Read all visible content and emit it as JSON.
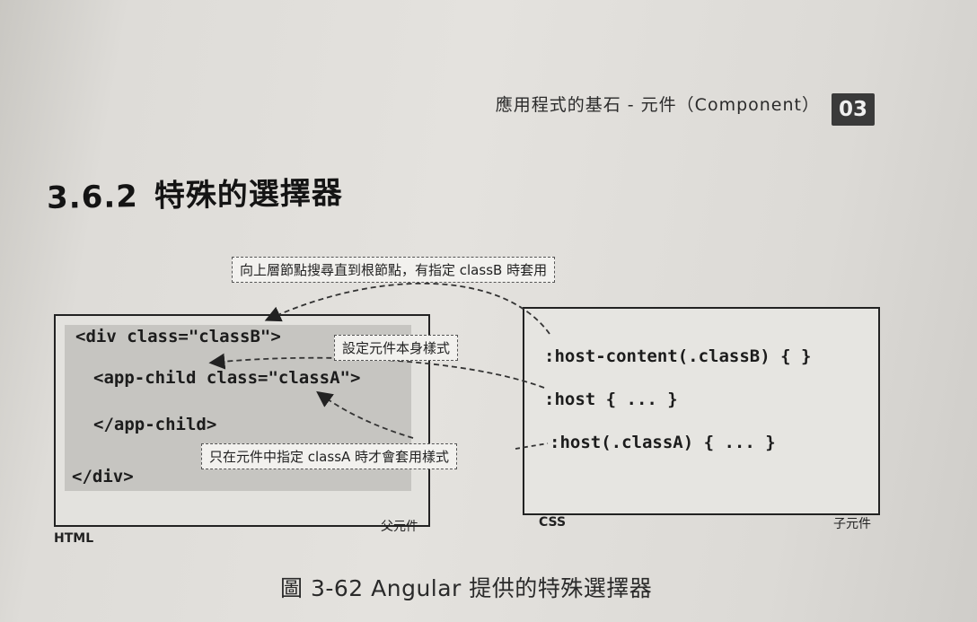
{
  "header": {
    "running_head": "應用程式的基石 - 元件（Component）",
    "chapter_number": "03"
  },
  "section": {
    "number": "3.6.2",
    "title": "特殊的選擇器"
  },
  "figure": {
    "callouts": {
      "top": "向上層節點搜尋直到根節點，有指定 classB 時套用",
      "middle": "設定元件本身樣式",
      "bottom": "只在元件中指定 classA 時才會套用樣式"
    },
    "html_code": [
      "<div class=\"classB\">",
      "<app-child class=\"classA\">",
      "</app-child>",
      "</div>"
    ],
    "css_code": [
      ":host-content(.classB) { }",
      ":host { ... }",
      ":host(.classA) { ... }"
    ],
    "labels": {
      "html": "HTML",
      "parent": "父元件",
      "css": "CSS",
      "child": "子元件"
    },
    "caption": "圖 3-62  Angular 提供的特殊選擇器"
  }
}
